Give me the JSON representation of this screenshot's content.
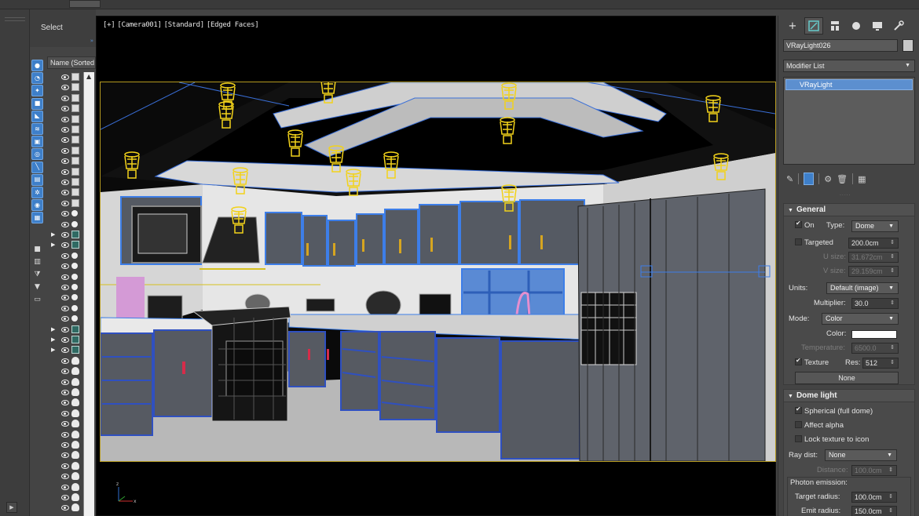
{
  "explorer": {
    "header": "Select",
    "column_header": "Name (Sorted Ascending)",
    "filter_icons": [
      "sphere-icon",
      "teapot-icon",
      "light-bulb-icon",
      "camera-icon",
      "helper-icon",
      "spacewarp-icon",
      "group-icon",
      "xref-icon",
      "bone-icon",
      "container-icon",
      "particle-icon",
      "display-icon",
      "layer-icon",
      "box-icon",
      "properties-icon",
      "filter-icon",
      "funnel-icon",
      "folder-icon"
    ],
    "rows": [
      {
        "expand": "",
        "icon": "geo"
      },
      {
        "expand": "",
        "icon": "geo"
      },
      {
        "expand": "",
        "icon": "geo"
      },
      {
        "expand": "",
        "icon": "geo"
      },
      {
        "expand": "",
        "icon": "geo"
      },
      {
        "expand": "",
        "icon": "geo"
      },
      {
        "expand": "",
        "icon": "geo"
      },
      {
        "expand": "",
        "icon": "geo"
      },
      {
        "expand": "",
        "icon": "geo"
      },
      {
        "expand": "",
        "icon": "geo"
      },
      {
        "expand": "",
        "icon": "geo"
      },
      {
        "expand": "",
        "icon": "geo"
      },
      {
        "expand": "",
        "icon": "geo"
      },
      {
        "expand": "",
        "icon": "dot"
      },
      {
        "expand": "",
        "icon": "dot"
      },
      {
        "expand": "▶",
        "icon": "grp"
      },
      {
        "expand": "▶",
        "icon": "grp"
      },
      {
        "expand": "",
        "icon": "dot"
      },
      {
        "expand": "",
        "icon": "dot"
      },
      {
        "expand": "",
        "icon": "dot"
      },
      {
        "expand": "",
        "icon": "dot"
      },
      {
        "expand": "",
        "icon": "dot"
      },
      {
        "expand": "",
        "icon": "dot"
      },
      {
        "expand": "",
        "icon": "dot"
      },
      {
        "expand": "▶",
        "icon": "grp"
      },
      {
        "expand": "▶",
        "icon": "grp"
      },
      {
        "expand": "▶",
        "icon": "grp"
      },
      {
        "expand": "",
        "icon": "light"
      },
      {
        "expand": "",
        "icon": "light"
      },
      {
        "expand": "",
        "icon": "light"
      },
      {
        "expand": "",
        "icon": "light"
      },
      {
        "expand": "",
        "icon": "light"
      },
      {
        "expand": "",
        "icon": "light"
      },
      {
        "expand": "",
        "icon": "light"
      },
      {
        "expand": "",
        "icon": "light"
      },
      {
        "expand": "",
        "icon": "light"
      },
      {
        "expand": "",
        "icon": "light"
      },
      {
        "expand": "",
        "icon": "light"
      },
      {
        "expand": "",
        "icon": "light"
      },
      {
        "expand": "",
        "icon": "light"
      },
      {
        "expand": "",
        "icon": "light"
      },
      {
        "expand": "",
        "icon": "light"
      }
    ]
  },
  "viewport": {
    "labels": [
      "[+]",
      "[Camera001]",
      "[Standard]",
      "[Edged Faces]"
    ],
    "selection_color": "#b59a20",
    "light_color": "#f2d21a"
  },
  "command_panel": {
    "tab_icons": [
      "create-icon",
      "modify-icon",
      "hierarchy-icon",
      "motion-icon",
      "display-icon",
      "utilities-icon"
    ],
    "object_name": "VRayLight026",
    "modifier_list": "Modifier List",
    "stack_item": "VRayLight",
    "general": {
      "title": "General",
      "on_label": "On",
      "on_checked": true,
      "type_label": "Type:",
      "type_value": "Dome",
      "targeted_label": "Targeted",
      "targeted_checked": false,
      "target_distance": "200.0cm",
      "u_size_label": "U size:",
      "u_size": "31.672cm",
      "v_size_label": "V size:",
      "v_size": "29.159cm",
      "units_label": "Units:",
      "units_value": "Default (image)",
      "multiplier_label": "Multiplier:",
      "multiplier_value": "30.0",
      "mode_label": "Mode:",
      "mode_value": "Color",
      "color_label": "Color:",
      "color_value": "#ffffff",
      "temperature_label": "Temperature:",
      "temperature_value": "6500.0",
      "texture_label": "Texture",
      "texture_checked": true,
      "res_label": "Res:",
      "res_value": "512",
      "texture_button": "None"
    },
    "dome": {
      "title": "Dome light",
      "spherical_label": "Spherical (full dome)",
      "spherical_checked": true,
      "affect_alpha_label": "Affect alpha",
      "affect_alpha_checked": false,
      "lock_texture_label": "Lock texture to icon",
      "lock_texture_checked": false,
      "ray_dist_label": "Ray dist:",
      "ray_dist_value": "None",
      "distance_label": "Distance:",
      "distance_value": "100.0cm",
      "photon_label": "Photon emission:",
      "target_radius_label": "Target radius:",
      "target_radius_value": "100.0cm",
      "emit_radius_label": "Emit radius:",
      "emit_radius_value": "150.0cm"
    }
  }
}
